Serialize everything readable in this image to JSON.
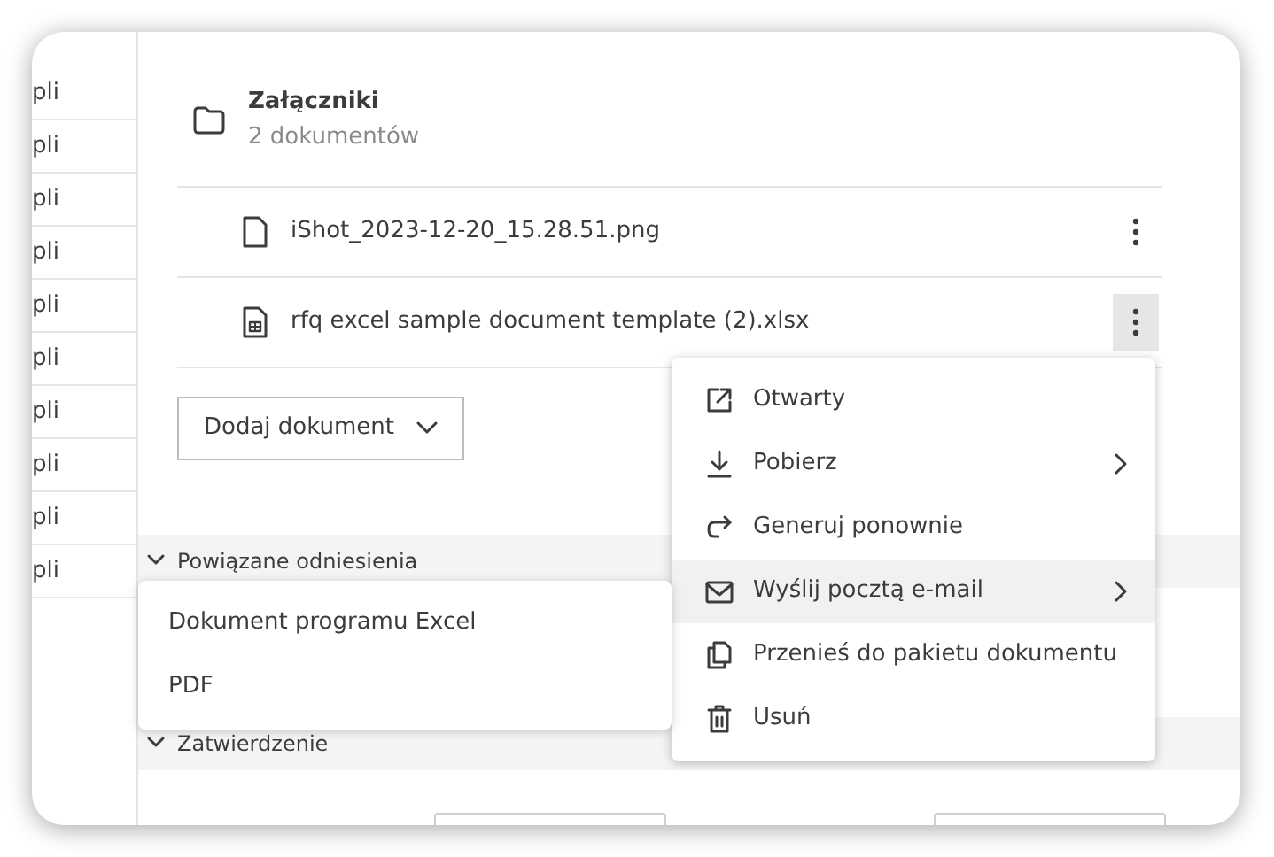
{
  "left_list": [
    "pli",
    "pli",
    "pli",
    "pli",
    "pli",
    "pli",
    "pli",
    "pli",
    "pli",
    "pli"
  ],
  "attachments": {
    "title": "Załączniki",
    "count": "2 dokumentów",
    "files": [
      {
        "name": "iShot_2023-12-20_15.28.51.png",
        "kind": "file",
        "menu_open": false
      },
      {
        "name": "rfq excel sample document template (2).xlsx",
        "kind": "sheet",
        "menu_open": true
      }
    ],
    "add_button": "Dodaj dokument"
  },
  "sections": [
    {
      "title": "Powiązane odniesienia",
      "expanded": true
    },
    {
      "title": "Zatwierdzenie",
      "expanded": true
    }
  ],
  "context_menu": [
    {
      "label": "Otwarty",
      "kind": "open",
      "submenu": false,
      "selected": false
    },
    {
      "label": "Pobierz",
      "kind": "download",
      "submenu": true,
      "selected": false
    },
    {
      "label": "Generuj ponownie",
      "kind": "redo",
      "submenu": false,
      "selected": false
    },
    {
      "label": "Wyślij pocztą e-mail",
      "kind": "mail",
      "submenu": true,
      "selected": true
    },
    {
      "label": "Przenieś do pakietu dokumentu",
      "kind": "copy",
      "submenu": false,
      "selected": false
    },
    {
      "label": "Usuń",
      "kind": "trash",
      "submenu": false,
      "selected": false
    }
  ],
  "submenu": [
    "Dokument programu Excel",
    "PDF"
  ]
}
